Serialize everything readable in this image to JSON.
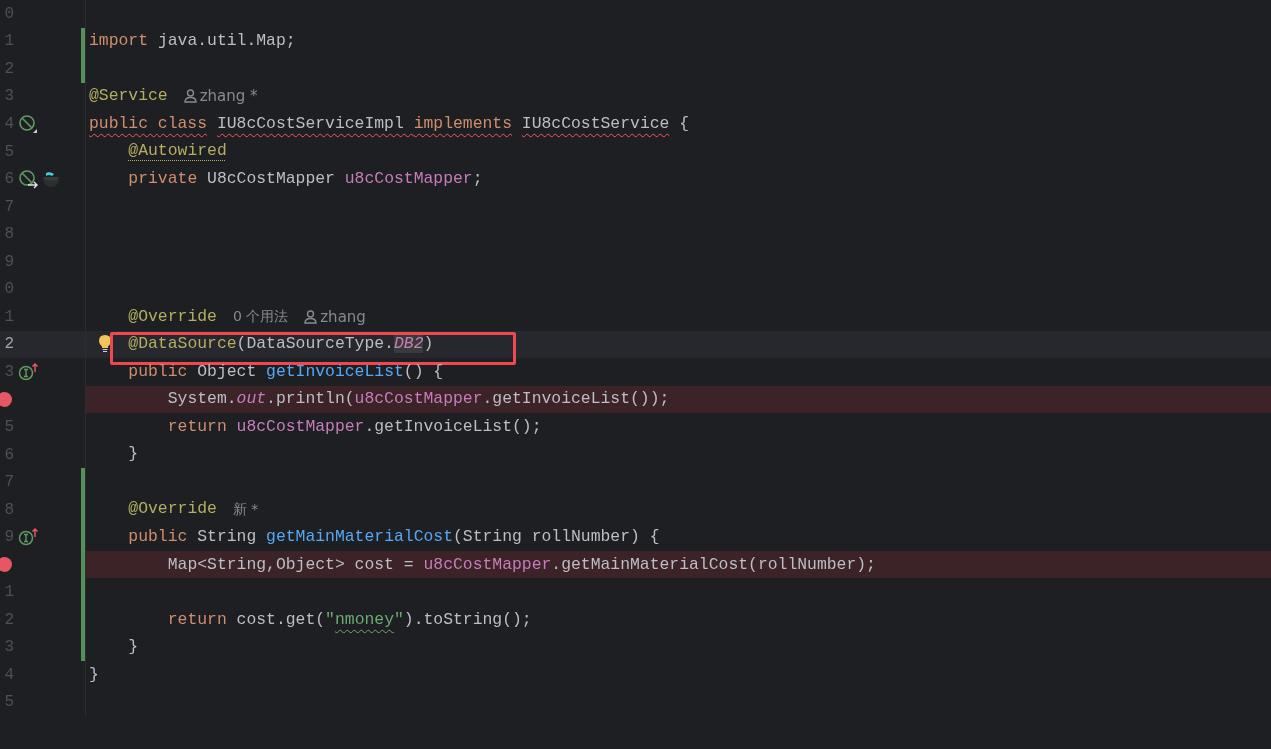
{
  "lines": [
    {
      "number": "0"
    },
    {
      "number": "1",
      "changed": true,
      "tokens": [
        {
          "text": "import",
          "kind": "kw"
        },
        {
          "text": " java.util.Map;",
          "kind": "plain"
        }
      ]
    },
    {
      "number": "2",
      "changed": true
    },
    {
      "number": "3",
      "tokens": [
        {
          "text": "@Service",
          "kind": "ann"
        }
      ],
      "hints": [
        {
          "kind": "author",
          "text": "zhang *"
        }
      ]
    },
    {
      "number": "4",
      "gutter_icons": [
        {
          "kind": "bean"
        }
      ],
      "tokens": [
        {
          "text": "public ",
          "kind": "kw",
          "underline": {
            "kind": "error"
          }
        },
        {
          "text": "class",
          "kind": "kw",
          "underline": {
            "kind": "error"
          }
        },
        {
          "text": " IU8cCostServiceImpl ",
          "kind": "plain",
          "underline": {
            "kind": "error"
          }
        },
        {
          "text": "implements",
          "kind": "kw",
          "underline": {
            "kind": "error"
          }
        },
        {
          "text": " IU8cCostService",
          "kind": "plain",
          "underline": {
            "kind": "error"
          }
        },
        {
          "text": " {",
          "kind": "plain"
        }
      ]
    },
    {
      "number": "5",
      "tokens": [
        {
          "text": "    @Autowired",
          "kind": "ann",
          "underline": {
            "kind": "warning"
          }
        }
      ]
    },
    {
      "number": "6",
      "gutter_icons": [
        {
          "kind": "autowired"
        },
        {
          "kind": "bean-pot"
        }
      ],
      "tokens": [
        {
          "text": "    private",
          "kind": "kw"
        },
        {
          "text": " U8cCostMapper ",
          "kind": "plain"
        },
        {
          "text": "u8cCostMapper",
          "kind": "field"
        },
        {
          "text": ";",
          "kind": "plain"
        }
      ]
    },
    {
      "number": "7"
    },
    {
      "number": "8"
    },
    {
      "number": "9"
    },
    {
      "number": "0"
    },
    {
      "number": "1",
      "tokens": [
        {
          "text": "    @Override",
          "kind": "ann"
        }
      ],
      "hints": [
        {
          "kind": "usages",
          "text": "0 个用法"
        },
        {
          "kind": "author",
          "text": "zhang"
        }
      ]
    },
    {
      "number": "2",
      "current": true,
      "outlined": true,
      "intention": true,
      "tokens": [
        {
          "text": "    @DataSource",
          "kind": "ann"
        },
        {
          "text": "(DataSourceType.",
          "kind": "plain"
        },
        {
          "text": "DB2",
          "kind": "static",
          "highlighted": true
        },
        {
          "text": ")",
          "kind": "plain"
        }
      ]
    },
    {
      "number": "3",
      "gutter_icons": [
        {
          "kind": "implements"
        }
      ],
      "tokens": [
        {
          "text": "    public",
          "kind": "kw"
        },
        {
          "text": " Object ",
          "kind": "plain"
        },
        {
          "text": "getInvoiceList",
          "kind": "decl"
        },
        {
          "text": "() {",
          "kind": "plain"
        }
      ]
    },
    {
      "breakpoint": true,
      "tokens": [
        {
          "text": "        System.",
          "kind": "plain"
        },
        {
          "text": "out",
          "kind": "static"
        },
        {
          "text": ".println(",
          "kind": "plain"
        },
        {
          "text": "u8cCostMapper",
          "kind": "field"
        },
        {
          "text": ".getInvoiceList());",
          "kind": "plain"
        }
      ]
    },
    {
      "number": "5",
      "tokens": [
        {
          "text": "        return ",
          "kind": "kw"
        },
        {
          "text": "u8cCostMapper",
          "kind": "field"
        },
        {
          "text": ".getInvoiceList();",
          "kind": "plain"
        }
      ]
    },
    {
      "number": "6",
      "tokens": [
        {
          "text": "    }",
          "kind": "plain"
        }
      ]
    },
    {
      "number": "7",
      "changed": true
    },
    {
      "number": "8",
      "changed": true,
      "tokens": [
        {
          "text": "    @Override",
          "kind": "ann"
        }
      ],
      "hints": [
        {
          "kind": "usages",
          "text": "新 *"
        }
      ]
    },
    {
      "number": "9",
      "changed": true,
      "gutter_icons": [
        {
          "kind": "implements"
        }
      ],
      "tokens": [
        {
          "text": "    public",
          "kind": "kw"
        },
        {
          "text": " String ",
          "kind": "plain"
        },
        {
          "text": "getMainMaterialCost",
          "kind": "decl"
        },
        {
          "text": "(String rollNumber) {",
          "kind": "plain"
        }
      ]
    },
    {
      "breakpoint": true,
      "changed": true,
      "tokens": [
        {
          "text": "        Map<String,Object> cost = ",
          "kind": "plain"
        },
        {
          "text": "u8cCostMapper",
          "kind": "field"
        },
        {
          "text": ".getMainMaterialCost(rollNumber);",
          "kind": "plain"
        }
      ]
    },
    {
      "number": "1",
      "changed": true
    },
    {
      "number": "2",
      "changed": true,
      "tokens": [
        {
          "text": "        return",
          "kind": "kw"
        },
        {
          "text": " cost.get(",
          "kind": "plain"
        },
        {
          "text": "\"",
          "kind": "str"
        },
        {
          "text": "nmoney",
          "kind": "str",
          "underline": {
            "kind": "typo"
          }
        },
        {
          "text": "\"",
          "kind": "str"
        },
        {
          "text": ").toString();",
          "kind": "plain"
        }
      ]
    },
    {
      "number": "3",
      "changed": true,
      "tokens": [
        {
          "text": "    }",
          "kind": "plain"
        }
      ]
    },
    {
      "number": "4",
      "tokens": [
        {
          "text": "}",
          "kind": "plain"
        }
      ]
    },
    {
      "number": "5"
    }
  ]
}
